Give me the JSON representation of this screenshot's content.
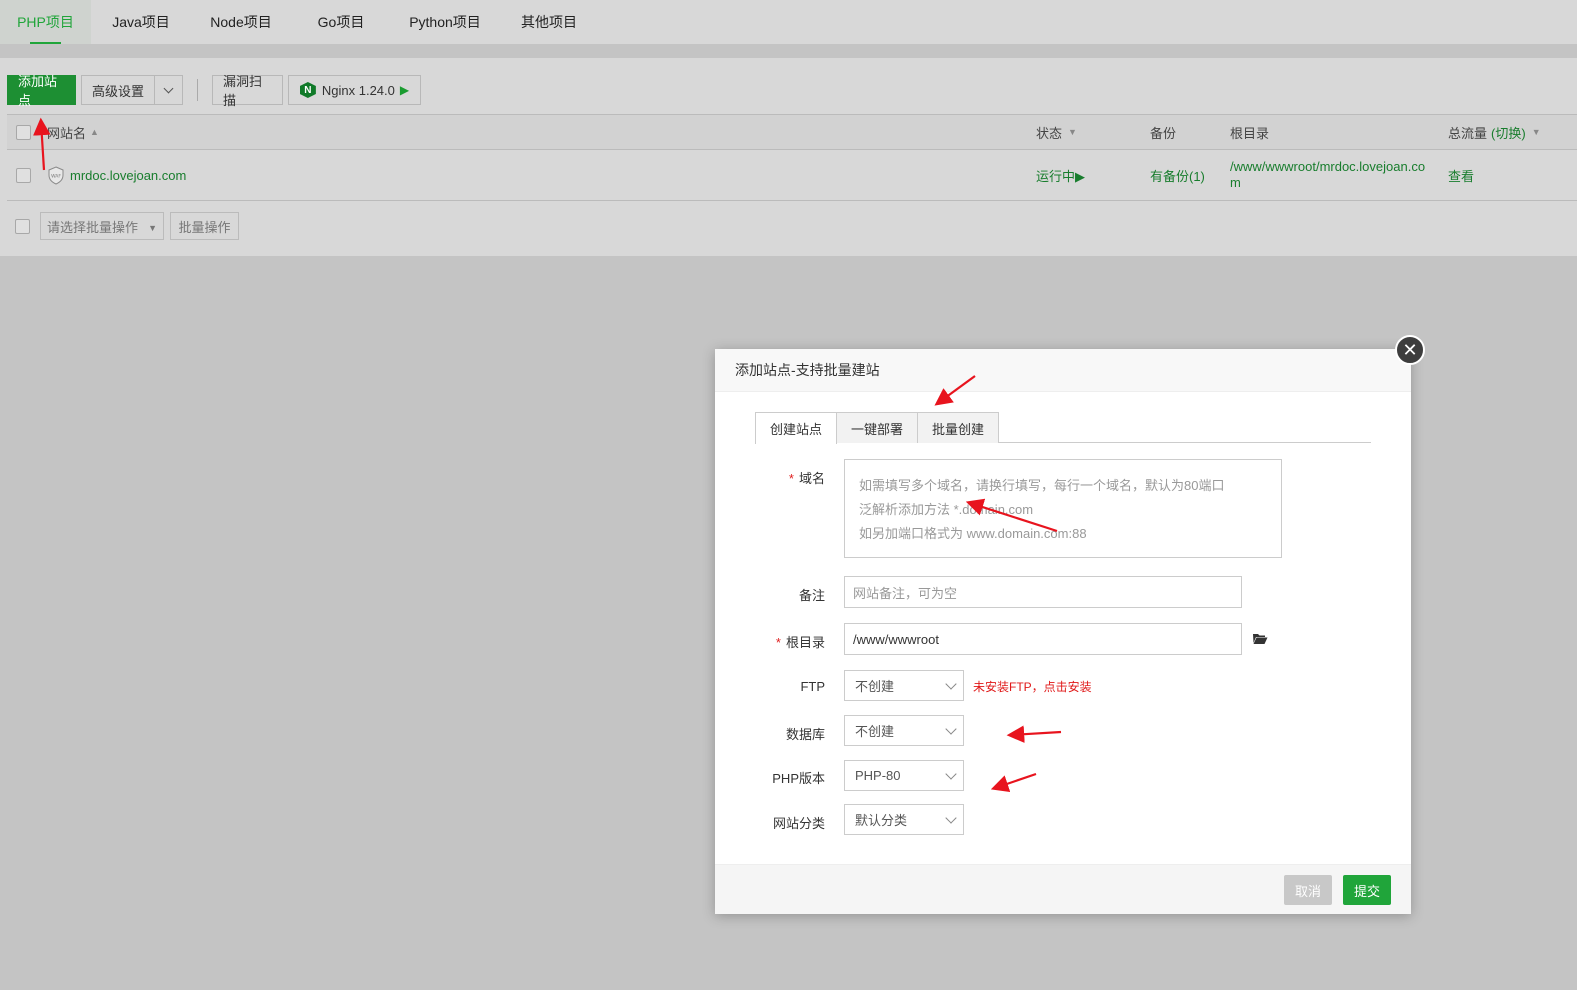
{
  "top_tabs": [
    "PHP项目",
    "Java项目",
    "Node项目",
    "Go项目",
    "Python项目",
    "其他项目"
  ],
  "toolbar": {
    "add_site": "添加站点",
    "advanced": "高级设置",
    "scan": "漏洞扫描",
    "nginx": "Nginx 1.24.0"
  },
  "table": {
    "headers": {
      "site_name": "网站名",
      "status": "状态",
      "backup": "备份",
      "root": "根目录",
      "traffic": "总流量",
      "switch": "(切换)"
    },
    "rows": [
      {
        "name": "mrdoc.lovejoan.com",
        "status": "运行中▶",
        "backup": "有备份(1)",
        "root_line1": "/www/wwwroot/mrdoc.lovejoan.co",
        "root_line2": "m",
        "traffic": "查看"
      }
    ]
  },
  "batch": {
    "select_placeholder": "请选择批量操作",
    "button": "批量操作"
  },
  "modal": {
    "title": "添加站点-支持批量建站",
    "tabs": [
      "创建站点",
      "一键部署",
      "批量创建"
    ],
    "domain_label": "域名",
    "domain_hint1": "如需填写多个域名，请换行填写，每行一个域名，默认为80端口",
    "domain_hint2": "泛解析添加方法 *.domain.com",
    "domain_hint3": "如另加端口格式为 www.domain.com:88",
    "remark_label": "备注",
    "remark_placeholder": "网站备注，可为空",
    "root_label": "根目录",
    "root_value": "/www/wwwroot",
    "ftp_label": "FTP",
    "ftp_value": "不创建",
    "ftp_warning": "未安装FTP，点击安装",
    "db_label": "数据库",
    "db_value": "不创建",
    "php_label": "PHP版本",
    "php_value": "PHP-80",
    "category_label": "网站分类",
    "category_value": "默认分类",
    "cancel": "取消",
    "submit": "提交"
  }
}
